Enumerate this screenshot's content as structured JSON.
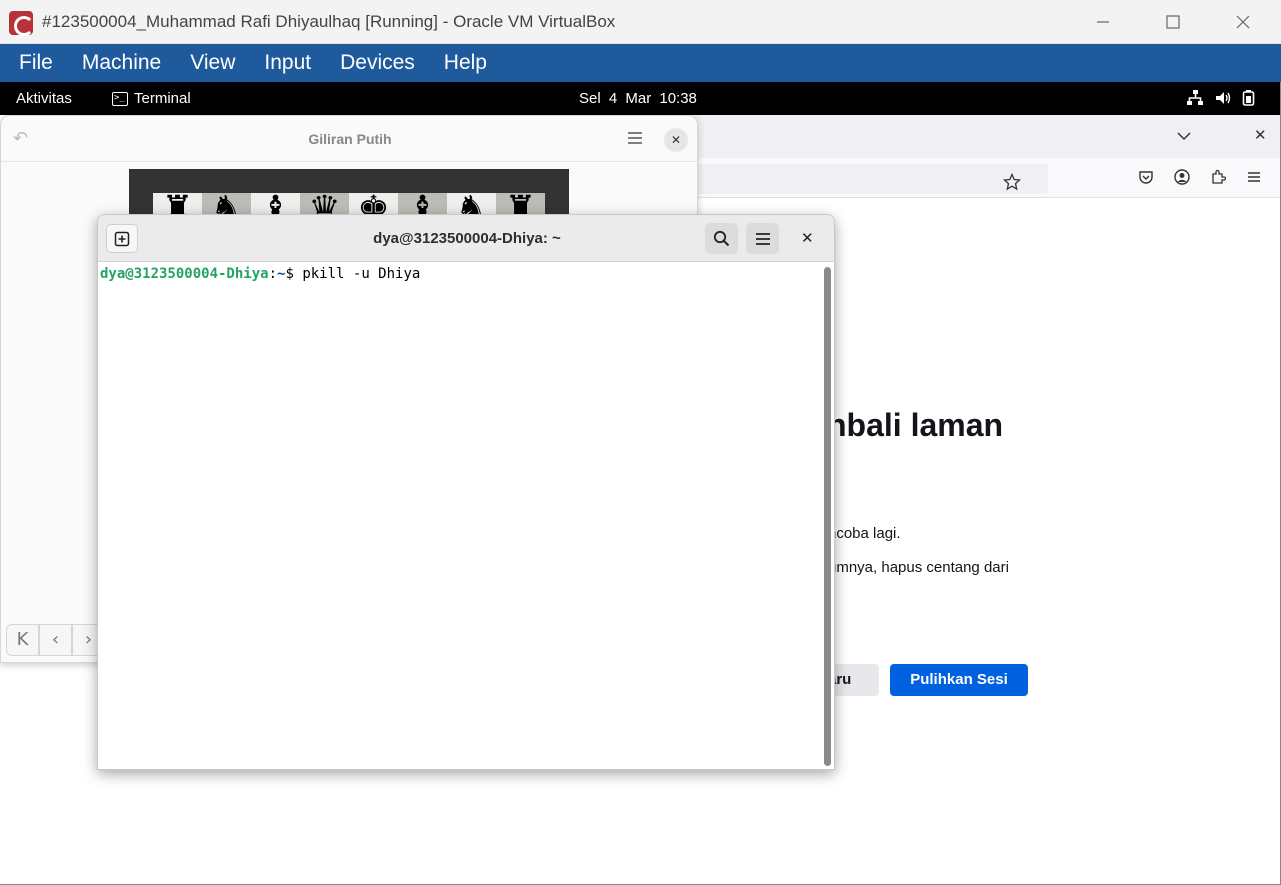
{
  "host_window": {
    "title": "#123500004_Muhammad Rafi Dhiyaulhaq [Running] - Oracle VM VirtualBox",
    "logo_icon": "virtualbox-debian-icon",
    "controls": [
      "minimize-icon",
      "maximize-icon",
      "close-icon"
    ]
  },
  "menubar": {
    "items": [
      "File",
      "Machine",
      "View",
      "Input",
      "Devices",
      "Help"
    ],
    "background": "#1f5a9c"
  },
  "gnome": {
    "activities": "Aktivitas",
    "app_name": "Terminal",
    "clock": "Sel  4 Mar  10:38",
    "tray_icons": [
      "network-icon",
      "volume-icon",
      "battery-icon"
    ]
  },
  "chess": {
    "title": "Giliran Putih",
    "pieces": [
      "♜",
      "♞",
      "♝",
      "♛",
      "♚",
      "♝",
      "♞",
      "♜"
    ]
  },
  "firefox": {
    "heading": "nbali laman",
    "para1": "ncoba lagi.",
    "para2": "umnya, hapus centang dari",
    "btn_new": "aru",
    "btn_restore": "Pulihkan Sesi",
    "accent": "#0061e0"
  },
  "terminal": {
    "title": "dya@3123500004-Dhiya: ~",
    "prompt_user": "dya@3123500004-Dhiya",
    "prompt_sep": ":",
    "prompt_path": "~",
    "prompt_symbol": "$ ",
    "command": "pkill -u Dhiya",
    "user_color": "#26a269"
  }
}
